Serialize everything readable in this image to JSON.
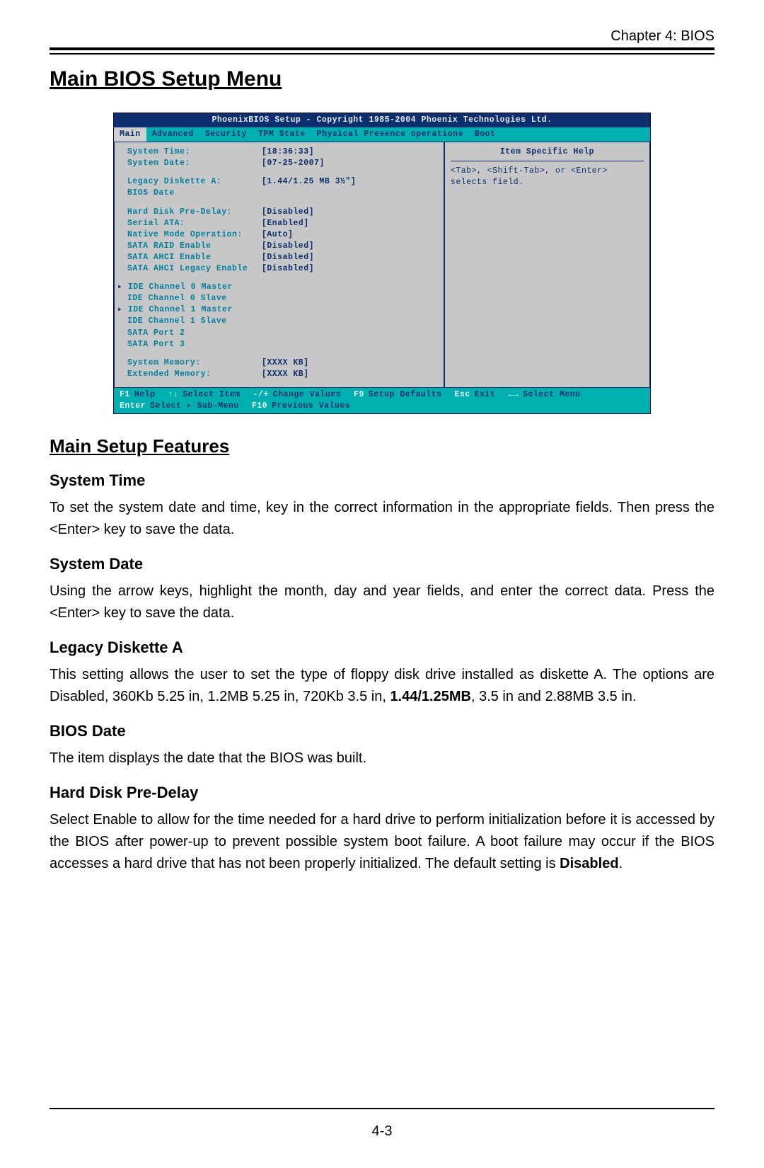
{
  "header": {
    "chapter": "Chapter 4: BIOS"
  },
  "title": "Main BIOS Setup Menu",
  "bios": {
    "title": "PhoenixBIOS Setup - Copyright 1985-2004 Phoenix Technologies Ltd.",
    "tabs": [
      "Main",
      "Advanced",
      "Security",
      "TPM State",
      "Physical Presence operations",
      "Boot"
    ],
    "rows": [
      {
        "label": "System Time:",
        "value": "[18:36:33]"
      },
      {
        "label": "System Date:",
        "value": "[07-25-2007]"
      },
      {
        "label": "",
        "value": ""
      },
      {
        "label": "Legacy Diskette A:",
        "value": "[1.44/1.25 MB  3½\"]"
      },
      {
        "label": "BIOS Date",
        "value": ""
      },
      {
        "label": "",
        "value": ""
      },
      {
        "label": "Hard Disk Pre-Delay:",
        "value": "[Disabled]"
      },
      {
        "label": "Serial ATA:",
        "value": "[Enabled]"
      },
      {
        "label": "Native Mode Operation:",
        "value": "[Auto]"
      },
      {
        "label": "SATA RAID Enable",
        "value": "[Disabled]"
      },
      {
        "label": "SATA AHCI Enable",
        "value": "[Disabled]"
      },
      {
        "label": "SATA AHCI Legacy Enable",
        "value": "[Disabled]"
      }
    ],
    "subs": [
      {
        "label": "IDE Channel 0 Master",
        "arrow": true
      },
      {
        "label": "IDE Channel 0 Slave",
        "arrow": false
      },
      {
        "label": "IDE Channel 1 Master",
        "arrow": true
      },
      {
        "label": "IDE Channel 1 Slave",
        "arrow": false
      },
      {
        "label": "SATA Port 2",
        "arrow": false
      },
      {
        "label": "SATA Port 3",
        "arrow": false
      }
    ],
    "mem": [
      {
        "label": "System Memory:",
        "value": "[XXXX KB]"
      },
      {
        "label": "Extended Memory:",
        "value": "[XXXX KB]"
      }
    ],
    "help": {
      "title": "Item Specific Help",
      "text": "<Tab>, <Shift-Tab>, or <Enter> selects field."
    },
    "footer": [
      {
        "key": "F1",
        "label": "Help"
      },
      {
        "key": "↑↓",
        "label": "Select Item"
      },
      {
        "key": "-/+",
        "label": "Change Values"
      },
      {
        "key": "F9",
        "label": "Setup Defaults"
      },
      {
        "key": "Esc",
        "label": "Exit"
      },
      {
        "key": "←→",
        "label": "Select Menu"
      },
      {
        "key": "Enter",
        "label": "Select ▸ Sub-Menu"
      },
      {
        "key": "F10",
        "label": "Previous Values"
      }
    ]
  },
  "features": {
    "heading": "Main Setup Features",
    "items": [
      {
        "title": "System Time",
        "body": "To set the system date and time, key in the correct information in the appropriate fields.  Then press the <Enter> key to save the data."
      },
      {
        "title": "System Date",
        "body": "Using the arrow keys, highlight the month, day and year fields, and enter the correct data.  Press the <Enter> key to save the data."
      },
      {
        "title": "Legacy Diskette A",
        "body_html": "This setting allows the user to set the type of floppy disk drive installed as diskette A. The options are Disabled, 360Kb 5.25 in, 1.2MB 5.25 in, 720Kb 3.5 in, <span class='bold'>1.44/1.25MB</span>, 3.5 in and 2.88MB 3.5 in."
      },
      {
        "title": "BIOS Date",
        "body": "The item displays the date that the BIOS was built."
      },
      {
        "title": "Hard Disk Pre-Delay",
        "body_html": "Select Enable to allow for the time needed for a hard drive to perform initialization before it is accessed by the BIOS after power-up to prevent possible system boot failure. A boot failure may occur if the BIOS accesses a hard drive that has not been properly initialized. The default setting is <span class='bold'>Disabled</span>."
      }
    ]
  },
  "page_number": "4-3"
}
